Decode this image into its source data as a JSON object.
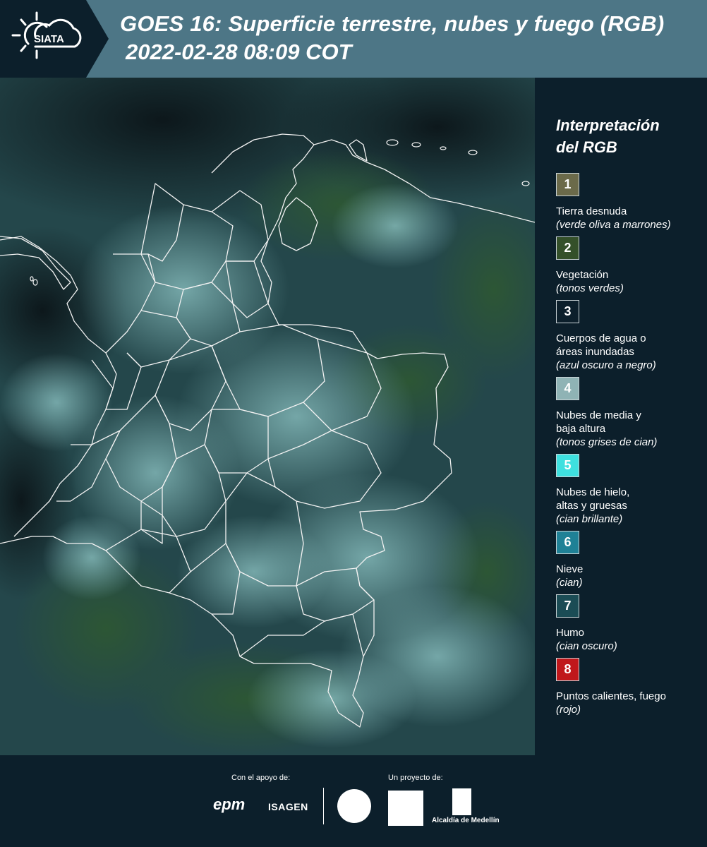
{
  "header": {
    "title": "GOES 16: Superficie terrestre, nubes y fuego (RGB)",
    "datetime": "2022-02-28 08:09 COT",
    "logo_text": "SIATA"
  },
  "legend": {
    "title": "Interpretación\ndel RGB",
    "items": [
      {
        "num": "1",
        "label": "Tierra desnuda",
        "sub": "(verde oliva a marrones)",
        "color": "#6b6a4a"
      },
      {
        "num": "2",
        "label": "Vegetación",
        "sub": "(tonos verdes)",
        "color": "#34502a"
      },
      {
        "num": "3",
        "label": "Cuerpos de agua o\náreas inundadas",
        "sub": "(azul oscuro a negro)",
        "color": "#0c1f2b"
      },
      {
        "num": "4",
        "label": "Nubes de media y\nbaja altura",
        "sub": "(tonos grises de cian)",
        "color": "#8fb3b5"
      },
      {
        "num": "5",
        "label": "Nubes de hielo,\naltas y gruesas",
        "sub": "(cian brillante)",
        "color": "#3ee0df"
      },
      {
        "num": "6",
        "label": "Nieve",
        "sub": "(cian)",
        "color": "#1f8196"
      },
      {
        "num": "7",
        "label": "Humo",
        "sub": "(cian oscuro)",
        "color": "#1b4c55"
      },
      {
        "num": "8",
        "label": "Puntos calientes, fuego",
        "sub": "(rojo)",
        "color": "#c0171b"
      }
    ]
  },
  "footer": {
    "support_label": "Con el apoyo de:",
    "project_label": "Un proyecto de:",
    "sponsor_1": "epm",
    "sponsor_2": "ISAGEN",
    "partner_alcaldia": "Alcaldía de Medellín"
  }
}
